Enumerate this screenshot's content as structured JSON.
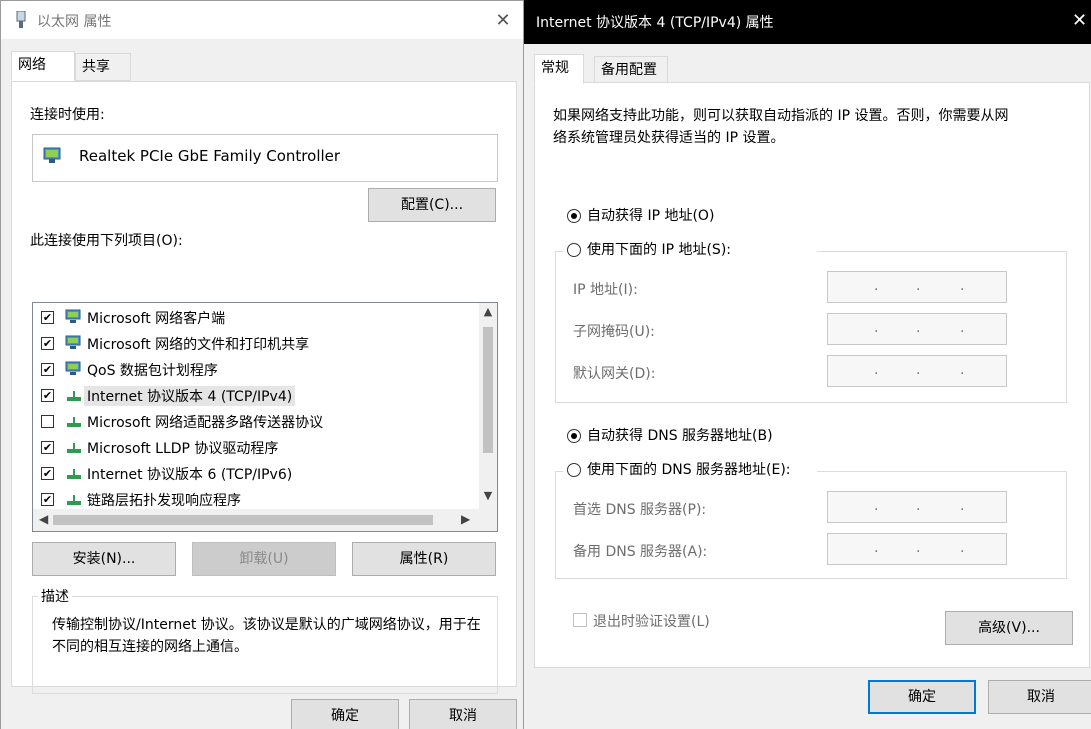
{
  "left_window": {
    "title": "以太网 属性",
    "tabs": [
      "网络",
      "共享"
    ],
    "connect_using_label": "连接时使用:",
    "adapter_name": "Realtek PCIe GbE Family Controller",
    "configure_button": "配置(C)...",
    "items_label": "此连接使用下列项目(O):",
    "items": [
      {
        "checked": true,
        "label": "Microsoft 网络客户端"
      },
      {
        "checked": true,
        "label": "Microsoft 网络的文件和打印机共享"
      },
      {
        "checked": true,
        "label": "QoS 数据包计划程序"
      },
      {
        "checked": true,
        "label": "Internet 协议版本 4 (TCP/IPv4)"
      },
      {
        "checked": false,
        "label": "Microsoft 网络适配器多路传送器协议"
      },
      {
        "checked": true,
        "label": "Microsoft LLDP 协议驱动程序"
      },
      {
        "checked": true,
        "label": "Internet 协议版本 6 (TCP/IPv6)"
      },
      {
        "checked": true,
        "label": "链路层拓扑发现响应程序"
      }
    ],
    "install_button": "安装(N)...",
    "uninstall_button": "卸载(U)",
    "properties_button": "属性(R)",
    "description_title": "描述",
    "description_text": "传输控制协议/Internet 协议。该协议是默认的广域网络协议，用于在不同的相互连接的网络上通信。",
    "ok_button": "确定",
    "cancel_button": "取消"
  },
  "right_window": {
    "title": "Internet 协议版本 4 (TCP/IPv4) 属性",
    "tabs": [
      "常规",
      "备用配置"
    ],
    "intro_text_line1": "如果网络支持此功能，则可以获取自动指派的 IP 设置。否则，你需要从网",
    "intro_text_line2": "络系统管理员处获得适当的 IP 设置。",
    "auto_ip_label": "自动获得 IP 地址(O)",
    "manual_ip_label": "使用下面的 IP 地址(S):",
    "ip_address_label": "IP 地址(I):",
    "subnet_mask_label": "子网掩码(U):",
    "gateway_label": "默认网关(D):",
    "auto_dns_label": "自动获得 DNS 服务器地址(B)",
    "manual_dns_label": "使用下面的 DNS 服务器地址(E):",
    "preferred_dns_label": "首选 DNS 服务器(P):",
    "alternate_dns_label": "备用 DNS 服务器(A):",
    "validate_on_exit_label": "退出时验证设置(L)",
    "advanced_button": "高级(V)...",
    "ok_button": "确定",
    "cancel_button": "取消",
    "ip_dot": "."
  }
}
